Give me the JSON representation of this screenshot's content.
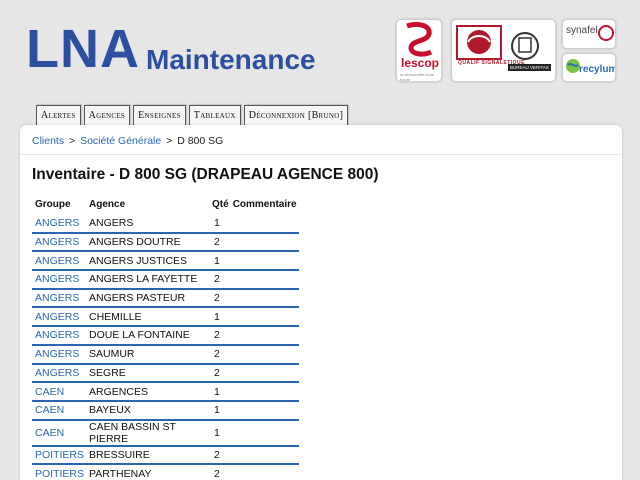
{
  "brand": {
    "lna": "LNA",
    "maintenance": "Maintenance"
  },
  "partners": {
    "lescop": "lescop",
    "lescop_sub": "la démocratie nous fonde",
    "qualif": "QUALIF SIGNALETIQUE",
    "veritas": "BUREAU VERITAS",
    "synafel": "synafel",
    "recylum": "recylum"
  },
  "tabs": [
    {
      "label": "Alertes"
    },
    {
      "label": "Agences"
    },
    {
      "label": "Enseignes"
    },
    {
      "label": "Tableaux"
    },
    {
      "label": "Déconnexion [Bruno]"
    }
  ],
  "breadcrumb": {
    "clients": "Clients",
    "societe": "Société Générale",
    "current": "D 800 SG",
    "sep": ">"
  },
  "title": "Inventaire - D 800 SG (DRAPEAU AGENCE 800)",
  "table": {
    "headers": {
      "groupe": "Groupe",
      "agence": "Agence",
      "qte": "Qté",
      "commentaire": "Commentaire"
    },
    "rows": [
      {
        "groupe": "ANGERS",
        "agence": "ANGERS",
        "qte": "1",
        "commentaire": ""
      },
      {
        "groupe": "ANGERS",
        "agence": "ANGERS DOUTRE",
        "qte": "2",
        "commentaire": ""
      },
      {
        "groupe": "ANGERS",
        "agence": "ANGERS JUSTICES",
        "qte": "1",
        "commentaire": ""
      },
      {
        "groupe": "ANGERS",
        "agence": "ANGERS LA FAYETTE",
        "qte": "2",
        "commentaire": ""
      },
      {
        "groupe": "ANGERS",
        "agence": "ANGERS PASTEUR",
        "qte": "2",
        "commentaire": ""
      },
      {
        "groupe": "ANGERS",
        "agence": "CHEMILLE",
        "qte": "1",
        "commentaire": ""
      },
      {
        "groupe": "ANGERS",
        "agence": "DOUE LA FONTAINE",
        "qte": "2",
        "commentaire": ""
      },
      {
        "groupe": "ANGERS",
        "agence": "SAUMUR",
        "qte": "2",
        "commentaire": ""
      },
      {
        "groupe": "ANGERS",
        "agence": "SEGRE",
        "qte": "2",
        "commentaire": ""
      },
      {
        "groupe": "CAEN",
        "agence": "ARGENCES",
        "qte": "1",
        "commentaire": ""
      },
      {
        "groupe": "CAEN",
        "agence": "BAYEUX",
        "qte": "1",
        "commentaire": ""
      },
      {
        "groupe": "CAEN",
        "agence": "CAEN BASSIN ST PIERRE",
        "qte": "1",
        "commentaire": ""
      },
      {
        "groupe": "POITIERS",
        "agence": "BRESSUIRE",
        "qte": "2",
        "commentaire": ""
      },
      {
        "groupe": "POITIERS",
        "agence": "PARTHENAY",
        "qte": "2",
        "commentaire": ""
      }
    ]
  },
  "colors": {
    "brand_blue": "#2d4fa0",
    "link_blue": "#2a66b0",
    "row_border": "#2a66b0",
    "background": "#e6e6e6"
  }
}
